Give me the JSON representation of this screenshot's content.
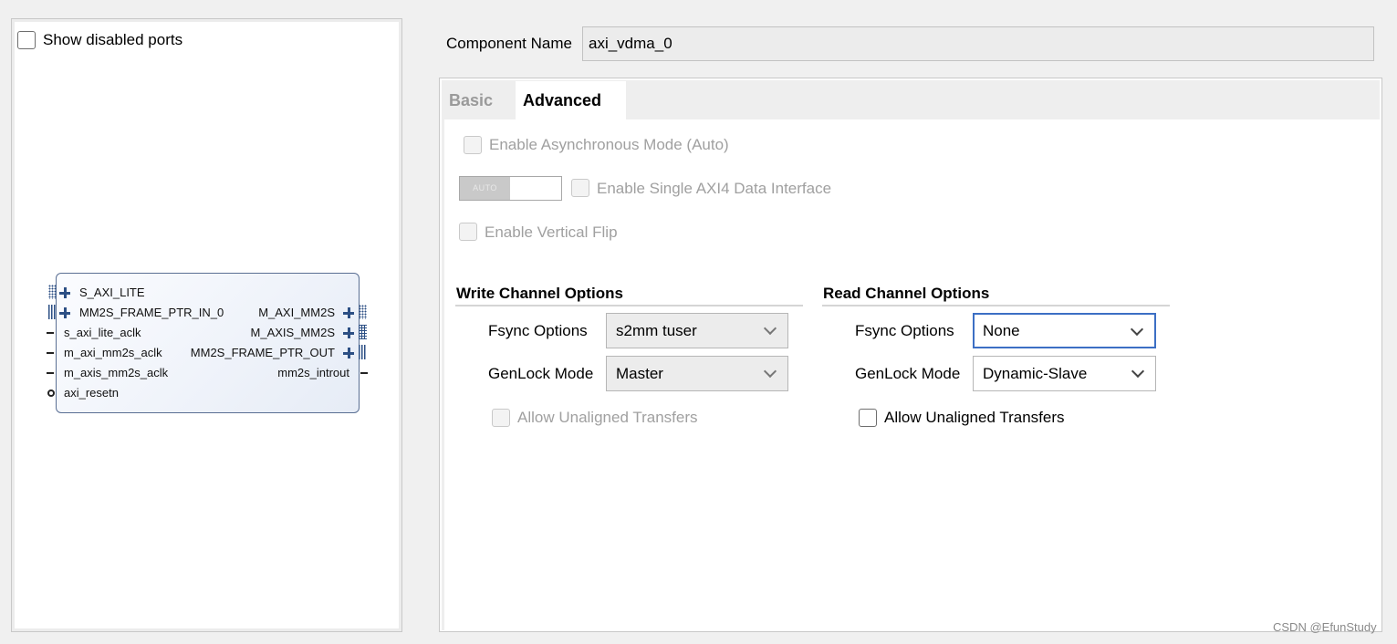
{
  "left_panel": {
    "show_disabled_ports_label": "Show disabled ports",
    "ip_block": {
      "left_ports": [
        {
          "label": "S_AXI_LITE",
          "kind": "bus"
        },
        {
          "label": "MM2S_FRAME_PTR_IN_0",
          "kind": "bus"
        },
        {
          "label": "s_axi_lite_aclk",
          "kind": "wire"
        },
        {
          "label": "m_axi_mm2s_aclk",
          "kind": "wire"
        },
        {
          "label": "m_axis_mm2s_aclk",
          "kind": "wire"
        },
        {
          "label": "axi_resetn",
          "kind": "reset"
        }
      ],
      "right_ports": [
        {
          "label": "M_AXI_MM2S",
          "kind": "bus"
        },
        {
          "label": "M_AXIS_MM2S",
          "kind": "bus"
        },
        {
          "label": "MM2S_FRAME_PTR_OUT",
          "kind": "bus"
        },
        {
          "label": "mm2s_introut",
          "kind": "wire"
        }
      ]
    }
  },
  "component": {
    "label": "Component Name",
    "value": "axi_vdma_0"
  },
  "tabs": [
    {
      "label": "Basic",
      "active": false
    },
    {
      "label": "Advanced",
      "active": true
    }
  ],
  "advanced": {
    "enable_async_label": "Enable Asynchronous Mode (Auto)",
    "toggle_label": "AUTO",
    "enable_single_axi4_label": "Enable Single AXI4 Data Interface",
    "enable_vertical_flip_label": "Enable Vertical Flip",
    "write_channel": {
      "title": "Write Channel Options",
      "fsync_label": "Fsync Options",
      "fsync_value": "s2mm tuser",
      "genlock_label": "GenLock Mode",
      "genlock_value": "Master",
      "unaligned_label": "Allow Unaligned Transfers"
    },
    "read_channel": {
      "title": "Read Channel Options",
      "fsync_label": "Fsync Options",
      "fsync_value": "None",
      "genlock_label": "GenLock Mode",
      "genlock_value": "Dynamic-Slave",
      "unaligned_label": "Allow Unaligned Transfers"
    }
  },
  "watermark": "CSDN @EfunStudy",
  "colors": {
    "focus_border": "#3c6fc4",
    "block_border": "#5a6f93",
    "port_icon": "#2c4f84"
  }
}
